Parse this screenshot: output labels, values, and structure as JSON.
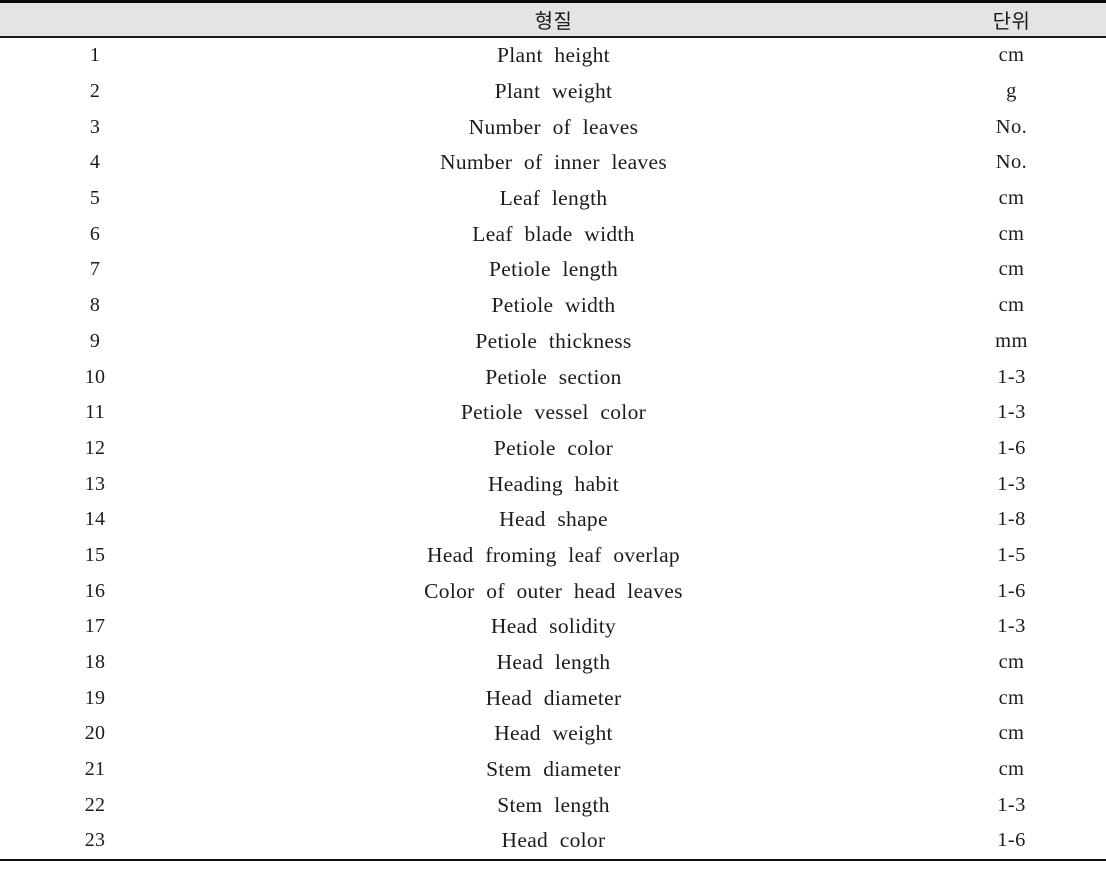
{
  "table": {
    "columns": {
      "number_header": "",
      "trait_header": "형질",
      "unit_header": "단위"
    },
    "rows": [
      {
        "no": "1",
        "trait": "Plant height",
        "unit": "cm"
      },
      {
        "no": "2",
        "trait": "Plant weight",
        "unit": "g"
      },
      {
        "no": "3",
        "trait": "Number of leaves",
        "unit": "No."
      },
      {
        "no": "4",
        "trait": "Number of inner leaves",
        "unit": "No."
      },
      {
        "no": "5",
        "trait": "Leaf length",
        "unit": "cm"
      },
      {
        "no": "6",
        "trait": "Leaf blade width",
        "unit": "cm"
      },
      {
        "no": "7",
        "trait": "Petiole length",
        "unit": "cm"
      },
      {
        "no": "8",
        "trait": "Petiole width",
        "unit": "cm"
      },
      {
        "no": "9",
        "trait": "Petiole thickness",
        "unit": "mm"
      },
      {
        "no": "10",
        "trait": "Petiole section",
        "unit": "1-3"
      },
      {
        "no": "11",
        "trait": "Petiole vessel color",
        "unit": "1-3"
      },
      {
        "no": "12",
        "trait": "Petiole color",
        "unit": "1-6"
      },
      {
        "no": "13",
        "trait": "Heading habit",
        "unit": "1-3"
      },
      {
        "no": "14",
        "trait": "Head shape",
        "unit": "1-8"
      },
      {
        "no": "15",
        "trait": "Head froming leaf overlap",
        "unit": "1-5"
      },
      {
        "no": "16",
        "trait": "Color of outer head leaves",
        "unit": "1-6"
      },
      {
        "no": "17",
        "trait": "Head solidity",
        "unit": "1-3"
      },
      {
        "no": "18",
        "trait": "Head length",
        "unit": "cm"
      },
      {
        "no": "19",
        "trait": "Head diameter",
        "unit": "cm"
      },
      {
        "no": "20",
        "trait": "Head weight",
        "unit": "cm"
      },
      {
        "no": "21",
        "trait": "Stem diameter",
        "unit": "cm"
      },
      {
        "no": "22",
        "trait": "Stem length",
        "unit": "1-3"
      },
      {
        "no": "23",
        "trait": "Head color",
        "unit": "1-6"
      }
    ]
  },
  "style": {
    "header_background": "#e4e4e4",
    "border_color": "#121212",
    "text_color": "#1c1c1c"
  }
}
